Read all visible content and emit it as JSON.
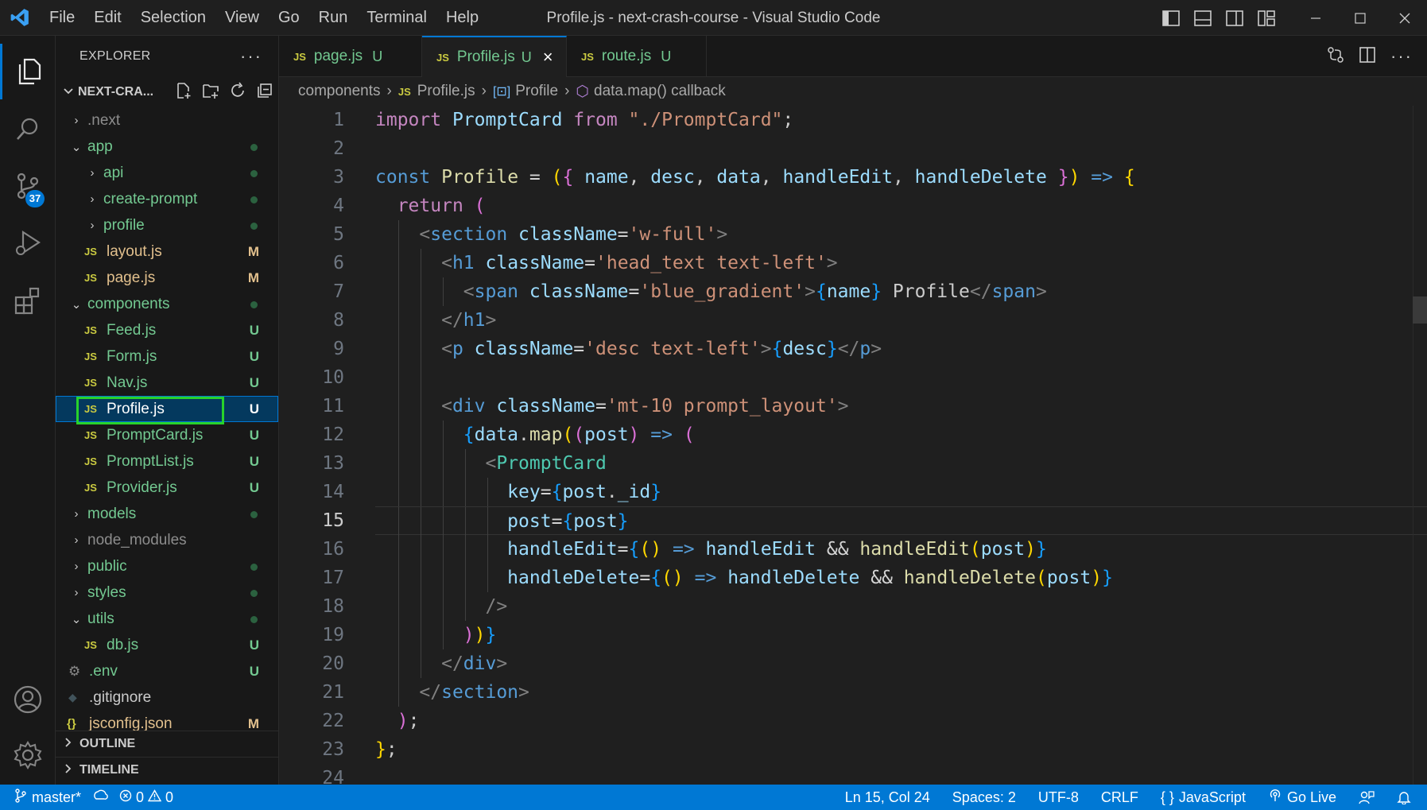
{
  "titlebar": {
    "menu": [
      "File",
      "Edit",
      "Selection",
      "View",
      "Go",
      "Run",
      "Terminal",
      "Help"
    ],
    "title": "Profile.js - next-crash-course - Visual Studio Code"
  },
  "activity": {
    "scm_badge": "37"
  },
  "explorer": {
    "title": "EXPLORER",
    "more": "···",
    "root_folder": "NEXT-CRA...",
    "items": [
      {
        "label": ".next",
        "kind": "folder",
        "collapsed": true,
        "status": ""
      },
      {
        "label": "app",
        "kind": "folder",
        "collapsed": false,
        "status": "dot"
      },
      {
        "label": "api",
        "kind": "folder",
        "collapsed": true,
        "status": "dot"
      },
      {
        "label": "create-prompt",
        "kind": "folder",
        "collapsed": true,
        "status": "dot"
      },
      {
        "label": "profile",
        "kind": "folder",
        "collapsed": true,
        "status": "dot"
      },
      {
        "label": "layout.js",
        "kind": "js",
        "status": "M"
      },
      {
        "label": "page.js",
        "kind": "js",
        "status": "M"
      },
      {
        "label": "components",
        "kind": "folder",
        "collapsed": false,
        "status": "dot"
      },
      {
        "label": "Feed.js",
        "kind": "js",
        "status": "U"
      },
      {
        "label": "Form.js",
        "kind": "js",
        "status": "U"
      },
      {
        "label": "Nav.js",
        "kind": "js",
        "status": "U"
      },
      {
        "label": "Profile.js",
        "kind": "js",
        "status": "U"
      },
      {
        "label": "PromptCard.js",
        "kind": "js",
        "status": "U"
      },
      {
        "label": "PromptList.js",
        "kind": "js",
        "status": "U"
      },
      {
        "label": "Provider.js",
        "kind": "js",
        "status": "U"
      },
      {
        "label": "models",
        "kind": "folder",
        "collapsed": true,
        "status": "dot"
      },
      {
        "label": "node_modules",
        "kind": "folder",
        "collapsed": true,
        "status": ""
      },
      {
        "label": "public",
        "kind": "folder",
        "collapsed": true,
        "status": "dot"
      },
      {
        "label": "styles",
        "kind": "folder",
        "collapsed": true,
        "status": "dot"
      },
      {
        "label": "utils",
        "kind": "folder",
        "collapsed": false,
        "status": "dot"
      },
      {
        "label": "db.js",
        "kind": "js",
        "status": "U"
      },
      {
        "label": ".env",
        "kind": "gear",
        "status": "U"
      },
      {
        "label": ".gitignore",
        "kind": "git",
        "status": ""
      },
      {
        "label": "jsconfig.json",
        "kind": "json",
        "status": "M"
      }
    ],
    "outline": "OUTLINE",
    "timeline": "TIMELINE"
  },
  "tabs": [
    {
      "label": "page.js",
      "status": "U"
    },
    {
      "label": "Profile.js",
      "status": "U"
    },
    {
      "label": "route.js",
      "status": "U"
    }
  ],
  "breadcrumb": {
    "folder": "components",
    "file": "Profile.js",
    "symbol": "Profile",
    "callback": "data.map() callback"
  },
  "editor": {
    "line_numbers": [
      "1",
      "2",
      "3",
      "4",
      "5",
      "6",
      "7",
      "8",
      "9",
      "10",
      "11",
      "12",
      "13",
      "14",
      "15",
      "16",
      "17",
      "18",
      "19",
      "20",
      "21",
      "22",
      "23",
      "24"
    ],
    "current_line": 15
  },
  "statusbar": {
    "branch": "master*",
    "errors": "0",
    "warnings": "0",
    "position": "Ln 15, Col 24",
    "spaces": "Spaces: 2",
    "encoding": "UTF-8",
    "eol": "CRLF",
    "language": "JavaScript",
    "golive": "Go Live"
  },
  "colors": {
    "accent": "#0078d4",
    "untracked": "#73c991",
    "modified": "#e2c08d",
    "selection_highlight": "#28d22b"
  },
  "icons": [
    "vscode-logo-icon",
    "files-icon",
    "search-icon",
    "source-control-icon",
    "run-debug-icon",
    "extensions-icon",
    "account-icon",
    "settings-gear-icon",
    "chevron-right-icon",
    "chevron-down-icon",
    "new-file-icon",
    "new-folder-icon",
    "refresh-icon",
    "collapse-all-icon",
    "close-icon",
    "split-editor-icon",
    "branch-icon",
    "sync-icon",
    "error-icon",
    "warning-icon",
    "broadcast-icon",
    "bell-icon",
    "feedback-icon"
  ]
}
